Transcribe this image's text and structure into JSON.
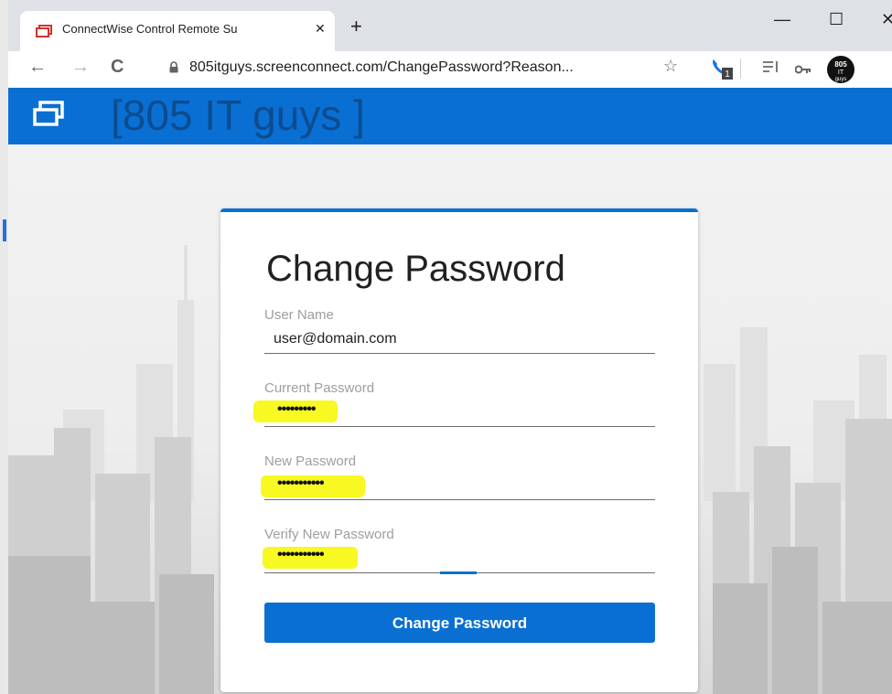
{
  "browser": {
    "tab_title": "ConnectWise Control Remote Su",
    "tab_close": "✕",
    "new_tab": "+",
    "url": "805itguys.screenconnect.com/ChangePassword?Reason...",
    "window_minimize": "—",
    "window_maximize": "☐",
    "window_close": "✕",
    "nav_back": "←",
    "nav_forward": "→",
    "nav_reload": "C",
    "bookmark_star": "☆",
    "extension_badge_count": "1",
    "profile_avatar_text": "805 IT guys"
  },
  "header": {
    "brand": "[805 IT guys ]"
  },
  "form": {
    "title": "Change Password",
    "fields": [
      {
        "label": "User Name",
        "value": "user@domain.com"
      },
      {
        "label": "Current Password",
        "value": "•••••••••"
      },
      {
        "label": "New Password",
        "value": "•••••••••••"
      },
      {
        "label": "Verify New Password",
        "value": "•••••••••••"
      }
    ],
    "submit_label": "Change Password"
  },
  "colors": {
    "accent": "#0a6fd3",
    "highlight": "#f7f70a",
    "brand_text": "#0d4784"
  },
  "icons": [
    "restore-window-icon",
    "lock-icon",
    "star-icon",
    "phone-extension-icon",
    "reading-list-icon",
    "key-icon",
    "profile-avatar-icon"
  ]
}
